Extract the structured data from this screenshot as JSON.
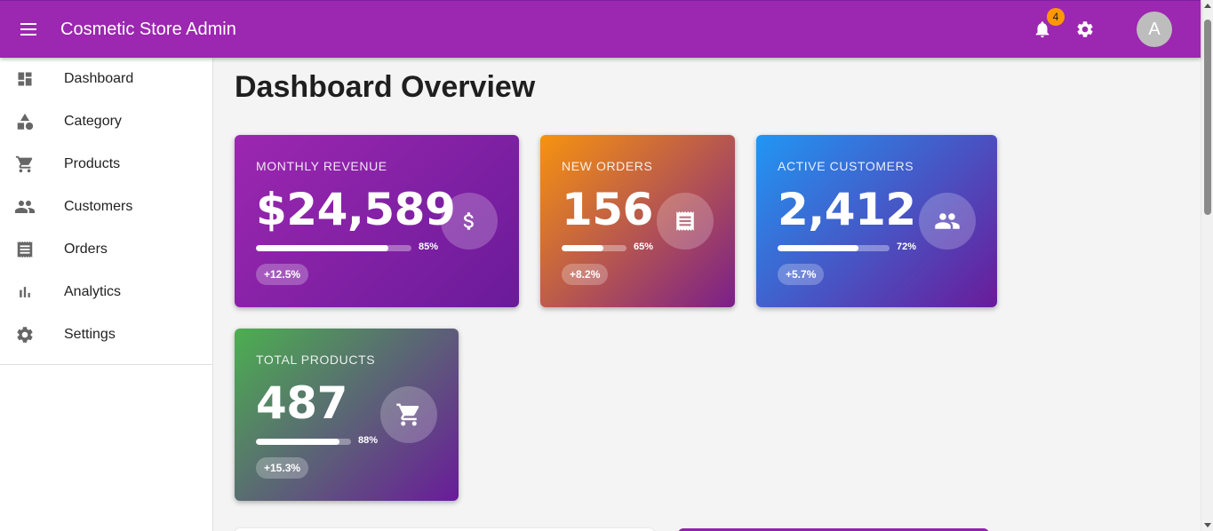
{
  "appbar": {
    "title": "Cosmetic Store Admin",
    "notification_count": "4",
    "avatar_letter": "A",
    "brand_color": "#9c27b0",
    "badge_color": "#ff9800"
  },
  "sidebar": {
    "items": [
      {
        "label": "Dashboard",
        "icon": "dashboard-icon"
      },
      {
        "label": "Category",
        "icon": "category-icon"
      },
      {
        "label": "Products",
        "icon": "cart-icon"
      },
      {
        "label": "Customers",
        "icon": "people-icon"
      },
      {
        "label": "Orders",
        "icon": "receipt-icon"
      },
      {
        "label": "Analytics",
        "icon": "bar-chart-icon"
      },
      {
        "label": "Settings",
        "icon": "gear-icon"
      }
    ]
  },
  "main": {
    "title": "Dashboard Overview",
    "cards": {
      "revenue": {
        "label": "MONTHLY REVENUE",
        "value": "$24,589",
        "progress": 0.85,
        "progress_label": "85%",
        "change": "+12.5%",
        "icon": "dollar-icon"
      },
      "orders": {
        "label": "NEW ORDERS",
        "value": "156",
        "progress": 0.65,
        "progress_label": "65%",
        "change": "+8.2%",
        "icon": "receipt-icon"
      },
      "customers": {
        "label": "ACTIVE CUSTOMERS",
        "value": "2,412",
        "progress": 0.72,
        "progress_label": "72%",
        "change": "+5.7%",
        "icon": "people-icon"
      },
      "products": {
        "label": "TOTAL PRODUCTS",
        "value": "487",
        "progress": 0.88,
        "progress_label": "88%",
        "change": "+15.3%",
        "icon": "cart-icon"
      }
    }
  }
}
